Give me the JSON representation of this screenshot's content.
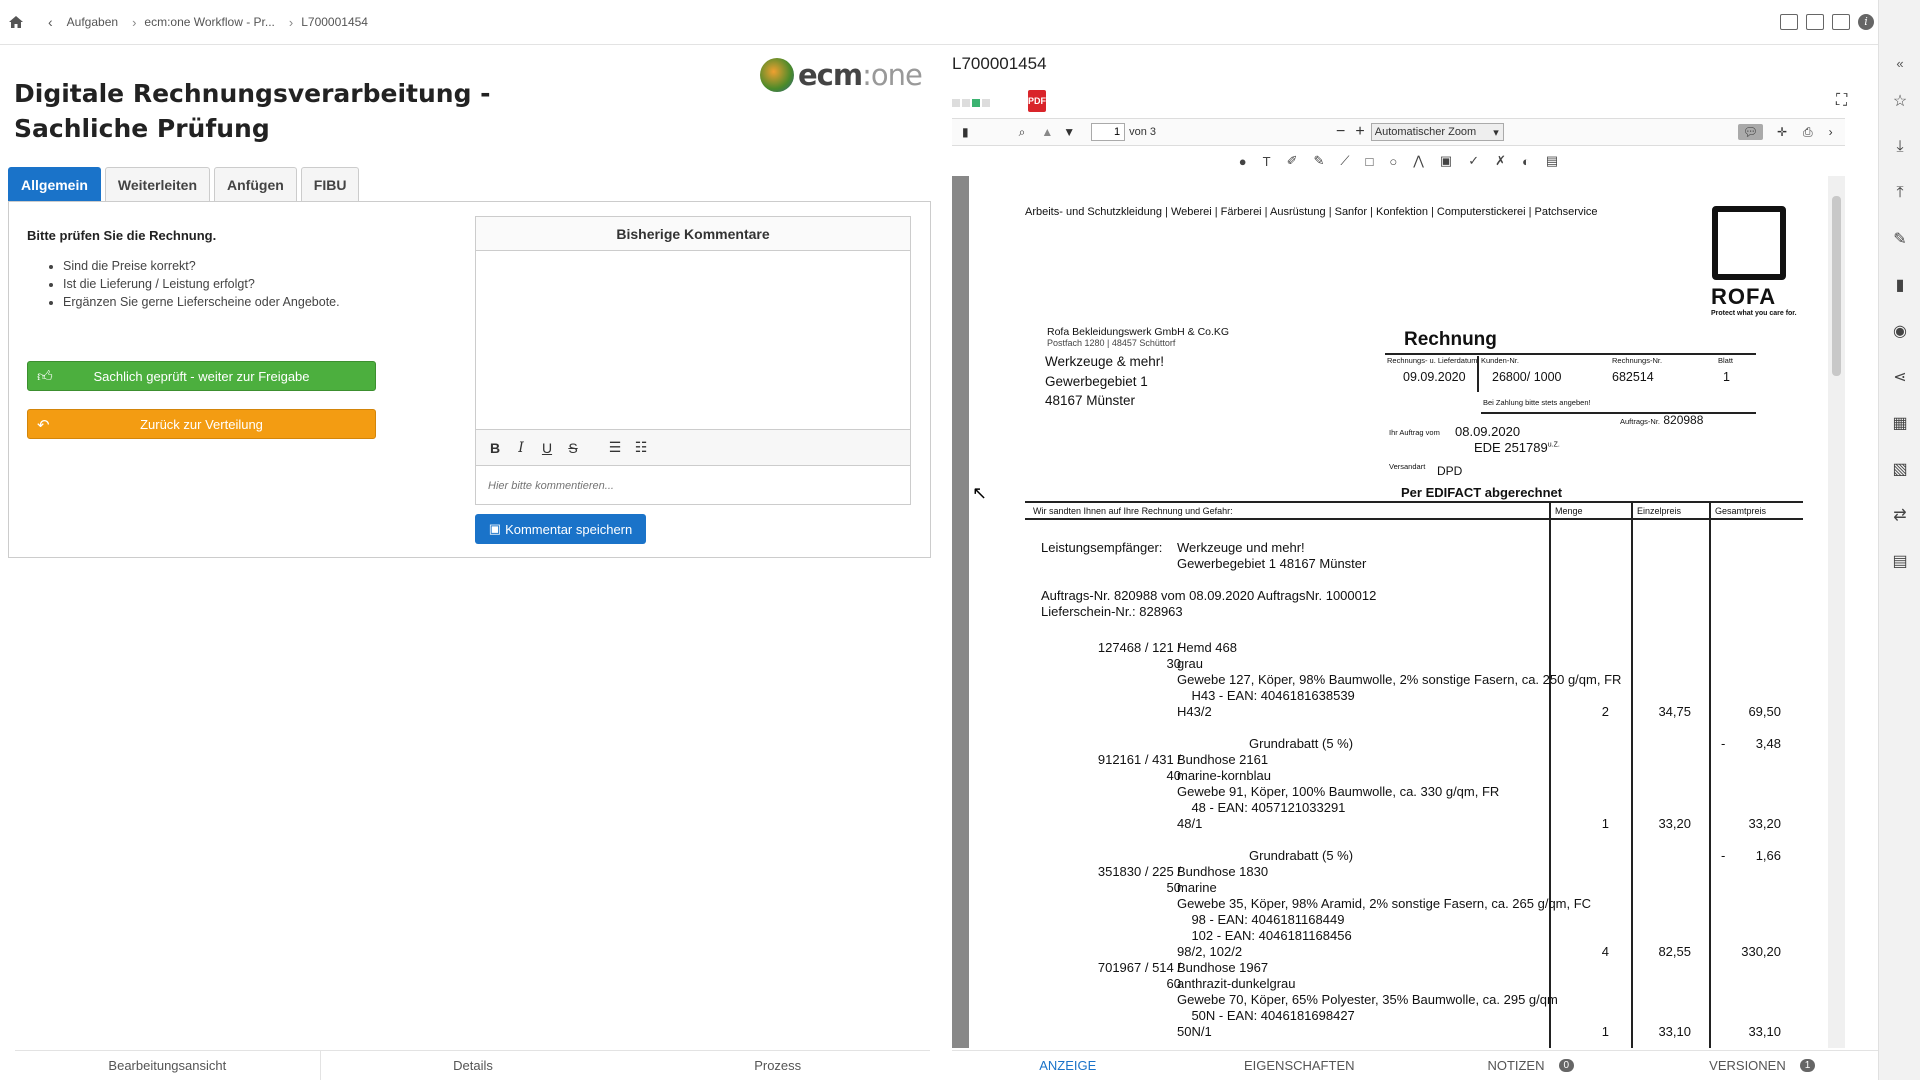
{
  "breadcrumb": {
    "items": [
      "Aufgaben",
      "ecm:one Workflow - Pr...",
      "L700001454"
    ]
  },
  "task": {
    "title_line1": "Digitale Rechnungsverarbeitung -",
    "title_line2": "Sachliche Prüfung"
  },
  "logo": {
    "text_main": "ecm",
    "text_rest": ":one"
  },
  "tabs": [
    {
      "label": "Allgemein",
      "active": true
    },
    {
      "label": "Weiterleiten"
    },
    {
      "label": "Anfügen"
    },
    {
      "label": "FIBU"
    }
  ],
  "instructions": {
    "heading": "Bitte prüfen Sie die Rechnung.",
    "items": [
      "Sind die Preise korrekt?",
      "Ist die Lieferung / Leistung erfolgt?",
      "Ergänzen Sie gerne Lieferscheine oder Angebote."
    ]
  },
  "actions": {
    "approve": "Sachlich geprüft - weiter zur Freigabe",
    "back": "Zurück zur Verteilung"
  },
  "comments": {
    "header": "Bisherige Kommentare",
    "placeholder": "Hier bitte kommentieren...",
    "save": "Kommentar speichern",
    "tools": [
      "B",
      "I",
      "U",
      "S"
    ]
  },
  "bottom_left_tabs": [
    "Bearbeitungsansicht",
    "Details",
    "Prozess"
  ],
  "viewer": {
    "doc_id": "L700001454",
    "page_current": "1",
    "page_total_label": "von 3",
    "zoom": "Automatischer Zoom"
  },
  "invoice": {
    "header_line": "Arbeits- und Schutzkleidung | Weberei | Färberei | Ausrüstung | Sanfor | Konfektion | Computerstickerei | Patchservice",
    "logo_text": "ROFA",
    "logo_tagline": "Protect what you care for.",
    "sender": "Rofa Bekleidungswerk GmbH & Co.KG",
    "sender_addr": "Postfach 1280 | 48457 Schüttorf",
    "recipient": [
      "Werkzeuge & mehr!",
      "Gewerbegebiet 1",
      "48167 Münster"
    ],
    "doc_type": "Rechnung",
    "hdr_labels": [
      "Rechnungs- u. Lieferdatum",
      "Kunden-Nr.",
      "Rechnungs-Nr.",
      "Blatt"
    ],
    "hdr_values": [
      "09.09.2020",
      "26800/ 1000",
      "682514",
      "1"
    ],
    "payment_note": "Bei Zahlung bitte stets angeben!",
    "order_no_label": "Auftrags-Nr.",
    "order_no": "820988",
    "order_date_label": "Ihr Auftrag vom",
    "order_date": "08.09.2020",
    "ede": "EDE 251789",
    "ede_suffix": "u.Z.",
    "shipping_label": "Versandart",
    "shipping": "DPD",
    "edifact": "Per EDIFACT abgerechnet",
    "table_intro": "Wir sandten Ihnen auf Ihre Rechnung und Gefahr:",
    "col_headers": [
      "Menge",
      "Einzelpreis",
      "Gesamtpreis"
    ],
    "recipient_label": "Leistungsempfänger:",
    "recipient_lines": [
      "Werkzeuge und mehr!",
      "Gewerbegebiet 1 48167 Münster"
    ],
    "order_line": "Auftrags-Nr. 820988 vom 08.09.2020 AuftragsNr. 1000012",
    "delivery_line": "Lieferschein-Nr.:  828963",
    "positions": [
      {
        "art": "127468 / 121 /",
        "art2": "30",
        "lines": [
          "Hemd 468",
          "grau",
          "Gewebe 127, Köper, 98% Baumwolle, 2% sonstige Fasern, ca. 250 g/qm, FR",
          "    H43 - EAN: 4046181638539",
          "H43/2"
        ],
        "menge": "2",
        "ep": "34,75",
        "gp": "69,50",
        "rabatt": "Grundrabatt (5 %)",
        "rabatt_val": "3,48"
      },
      {
        "art": "912161 / 431 /",
        "art2": "40",
        "lines": [
          "Bundhose 2161",
          "marine-kornblau",
          "Gewebe 91, Köper, 100% Baumwolle, ca. 330 g/qm, FR",
          "    48 - EAN: 4057121033291",
          "48/1"
        ],
        "menge": "1",
        "ep": "33,20",
        "gp": "33,20",
        "rabatt": "Grundrabatt (5 %)",
        "rabatt_val": "1,66"
      },
      {
        "art": "351830 / 225 /",
        "art2": "50",
        "lines": [
          "Bundhose 1830",
          "marine",
          "Gewebe 35, Köper, 98% Aramid, 2% sonstige Fasern, ca. 265 g/qm, FC",
          "    98 - EAN: 4046181168449",
          "    102 - EAN: 4046181168456",
          "98/2, 102/2"
        ],
        "menge": "4",
        "ep": "82,55",
        "gp": "330,20"
      },
      {
        "art": "701967 / 514 /",
        "art2": "60",
        "lines": [
          "Bundhose 1967",
          "anthrazit-dunkelgrau",
          "Gewebe 70, Köper, 65% Polyester, 35% Baumwolle, ca. 295 g/qm",
          "    50N - EAN: 4046181698427",
          "50N/1"
        ],
        "menge": "1",
        "ep": "33,10",
        "gp": "33,10"
      }
    ]
  },
  "bottom_right_tabs": [
    {
      "label": "ANZEIGE"
    },
    {
      "label": "EIGENSCHAFTEN"
    },
    {
      "label": "NOTIZEN",
      "badge": "0"
    },
    {
      "label": "VERSIONEN",
      "badge": "1"
    }
  ]
}
